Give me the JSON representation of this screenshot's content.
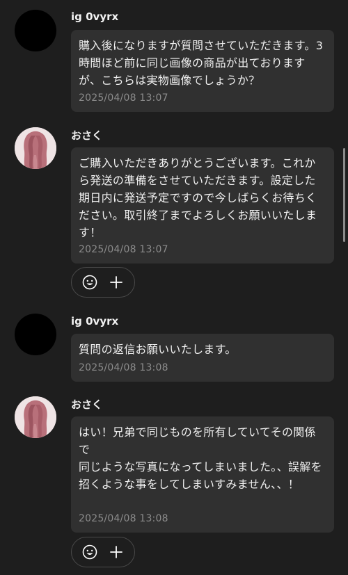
{
  "messages": [
    {
      "sender": "ig 0vyrx",
      "text": "購入後になりますが質問させていただきます。3時間ほど前に同じ画像の商品が出ておりますが、こちらは実物画像でしょうか？",
      "time": "2025/04/08 13:07"
    },
    {
      "sender": "おさく",
      "text": "ご購入いただきありがとうございます。これから発送の準備をさせていただきます。設定した期日内に発送予定ですので今しばらくお待ちください。取引終了までよろしくお願いいたします！",
      "time": "2025/04/08 13:07"
    },
    {
      "sender": "ig 0vyrx",
      "text": "質問の返信お願いいたします。",
      "time": "2025/04/08 13:08"
    },
    {
      "sender": "おさく",
      "text": "はい！兄弟で同じものを所有していてその関係で\n同じような写真になってしまいました。、誤解を招くような事をしてしまいすみません、、！",
      "time": "2025/04/08 13:08"
    }
  ],
  "icons": {
    "react": "smiley-icon",
    "add": "plus-icon"
  }
}
